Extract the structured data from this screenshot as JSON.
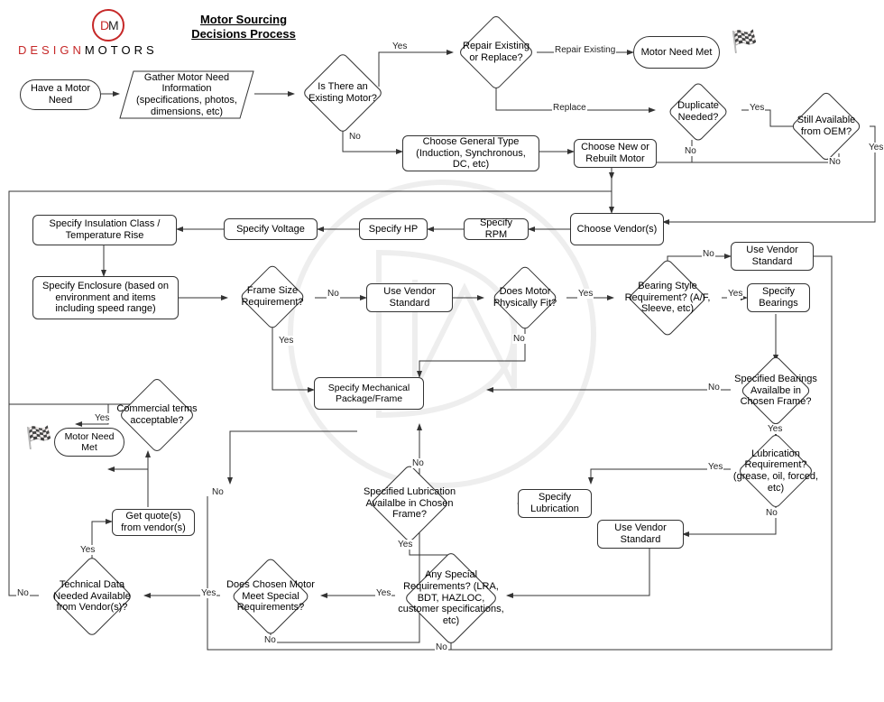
{
  "brand": {
    "name": "DESIGN",
    "name2": "MOTORS",
    "icon": "DM"
  },
  "title": "Motor Sourcing\nDecisions Process",
  "nodes": {
    "haveNeed": "Have a Motor Need",
    "gatherInfo": "Gather Motor Need Information (specifications, photos, dimensions, etc)",
    "existingMotor": "Is There an Existing Motor?",
    "repairReplace": "Repair Existing or Replace?",
    "motorNeedMet1": "Motor Need Met",
    "duplicateNeeded": "Duplicate Needed?",
    "oemAvailable": "Still Available from OEM?",
    "chooseType": "Choose General Type (Induction, Synchronous, DC, etc)",
    "newOrRebuilt": "Choose New or Rebuilt Motor",
    "chooseVendor": "Choose Vendor(s)",
    "specRPM": "Specify RPM",
    "specHP": "Specify HP",
    "specVoltage": "Specify Voltage",
    "specInsulation": "Specify Insulation Class / Temperature Rise",
    "specEnclosure": "Specify Enclosure (based on environment and items including speed range)",
    "frameSizeReq": "Frame Size Requirement?",
    "vendorStd1": "Use Vendor Standard",
    "motorFit": "Does Motor Physically Fit?",
    "bearingStyle": "Bearing Style Requirement? (A/F, Sleeve, etc)",
    "vendorStd2": "Use Vendor Standard",
    "specBearings": "Specify Bearings",
    "bearingsAvail": "Specified Bearings Availalbe in Chosen Frame?",
    "specMechPkg": "Specify Mechanical Package/Frame",
    "lubeReq": "Lubrication Requirement? (grease, oil, forced, etc)",
    "specLube": "Specify Lubrication",
    "lubeAvail": "Specified Lubrication Availalbe in Chosen Frame?",
    "vendorStd3": "Use Vendor Standard",
    "anySpecial": "Any Special Requirements? (LRA, BDT, HAZLOC, customer specifications, etc)",
    "meetSpecial": "Does Chosen Motor Meet Special Requirements?",
    "techData": "Technical Data Needed Available from Vendor(s)?",
    "getQuotes": "Get quote(s) from vendor(s)",
    "commTerms": "Commercial terms acceptable?",
    "motorNeedMet2": "Motor Need Met"
  },
  "labels": {
    "yes": "Yes",
    "no": "No",
    "repairExisting": "Repair Existing",
    "replace": "Replace"
  }
}
